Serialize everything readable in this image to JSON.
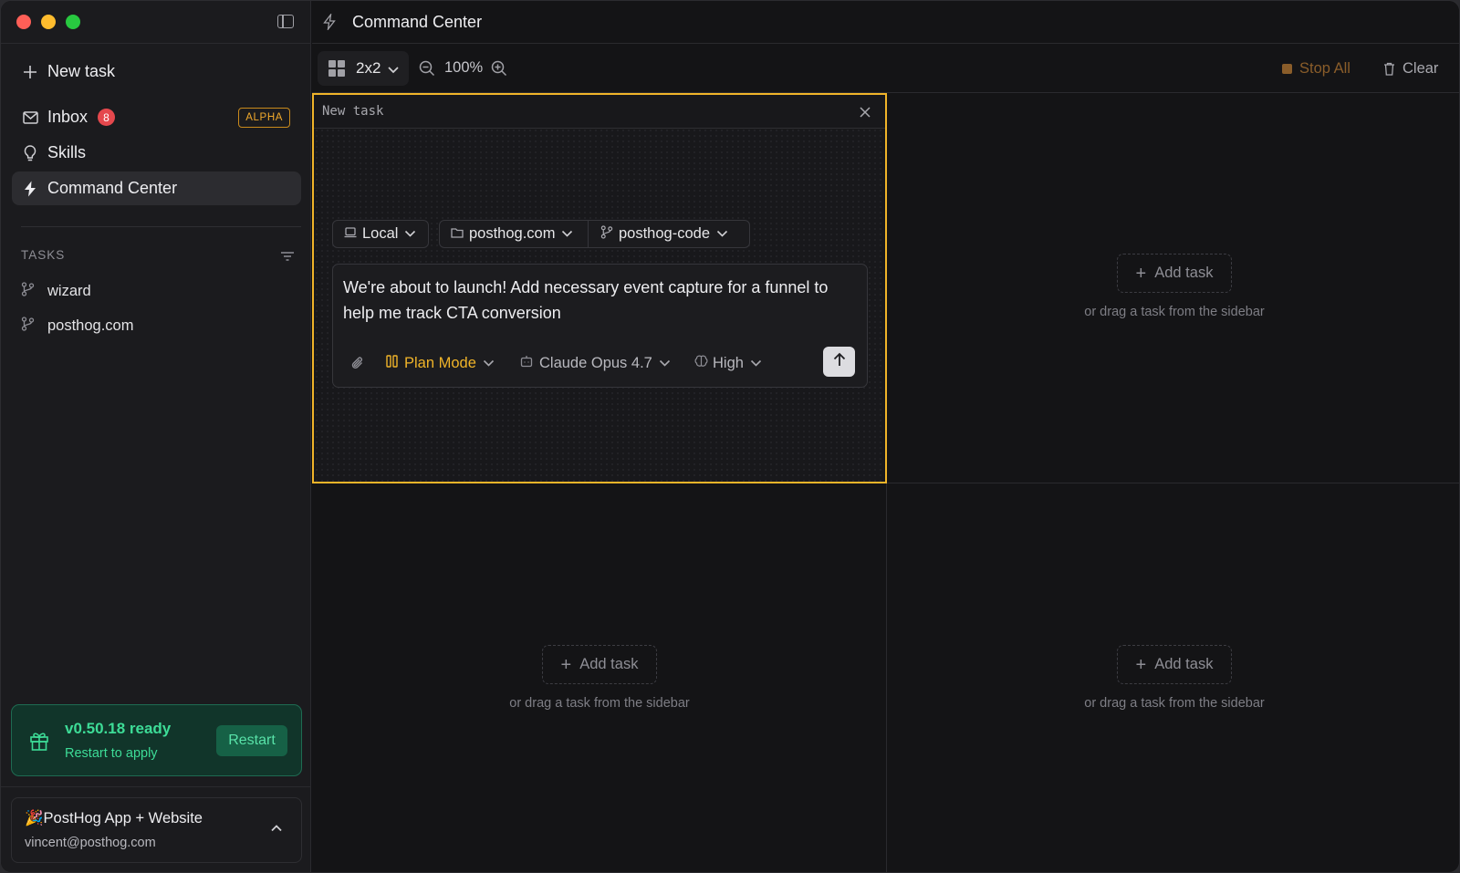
{
  "sidebar": {
    "new_task": "New task",
    "nav": [
      {
        "label": "Inbox",
        "badge": "8",
        "tag": "ALPHA"
      },
      {
        "label": "Skills"
      },
      {
        "label": "Command Center"
      }
    ],
    "tasks_heading": "TASKS",
    "tasks": [
      {
        "label": "wizard"
      },
      {
        "label": "posthog.com"
      }
    ],
    "update": {
      "title": "v0.50.18 ready",
      "subtitle": "Restart to apply",
      "button": "Restart"
    },
    "account": {
      "name": "PostHog App + Website",
      "emoji": "🎉",
      "email": "vincent@posthog.com"
    }
  },
  "header": {
    "title": "Command Center"
  },
  "toolbar": {
    "layout": "2x2",
    "zoom": "100%",
    "stop_all": "Stop All",
    "clear": "Clear"
  },
  "task_panel": {
    "title": "New task",
    "environment": "Local",
    "repository": "posthog.com",
    "branch": "posthog-code",
    "prompt": "We're about to launch! Add necessary event capture for a funnel to help me track CTA conversion",
    "mode": "Plan Mode",
    "model": "Claude Opus 4.7",
    "effort": "High"
  },
  "empty_cells": [
    {
      "button": "Add task",
      "hint": "or drag a task from the sidebar"
    },
    {
      "button": "Add task",
      "hint": "or drag a task from the sidebar"
    },
    {
      "button": "Add task",
      "hint": "or drag a task from the sidebar"
    }
  ],
  "colors": {
    "accent": "#f0b429",
    "badge": "#e5484d",
    "success": "#3ddc97",
    "stop": "#8a5d2a"
  }
}
